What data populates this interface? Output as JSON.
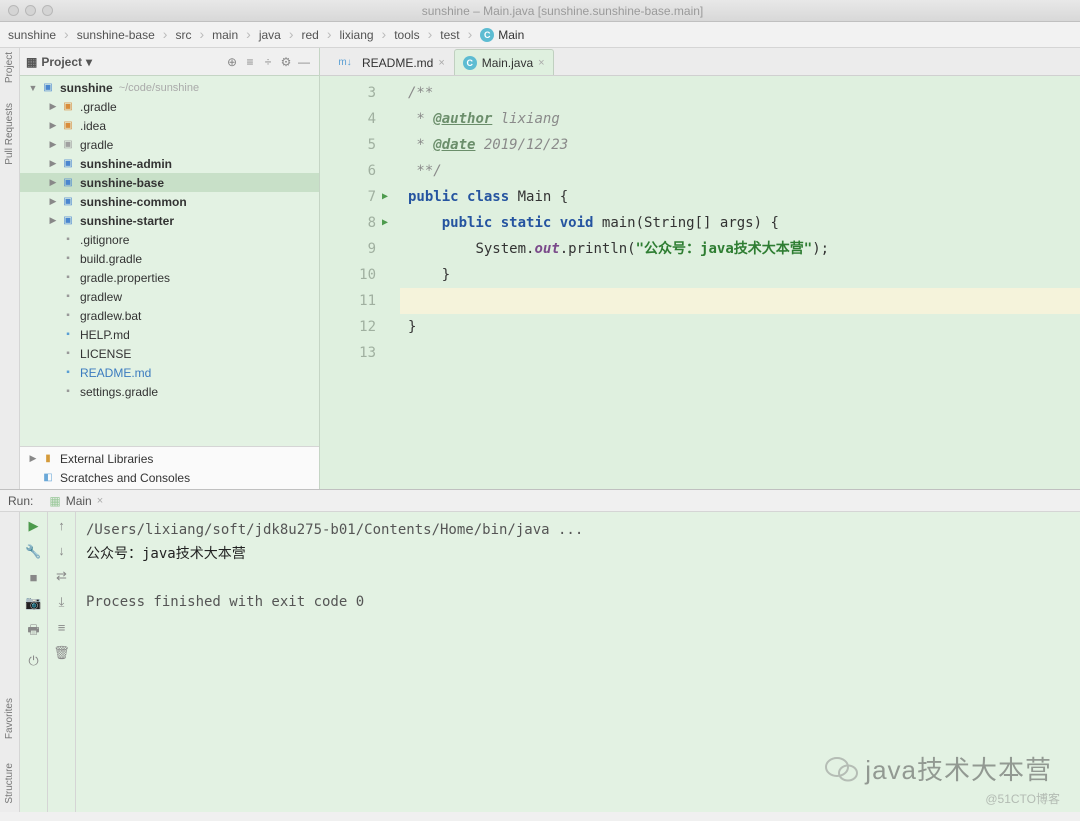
{
  "window": {
    "title": "sunshine – Main.java [sunshine.sunshine-base.main]"
  },
  "breadcrumb": [
    "sunshine",
    "sunshine-base",
    "src",
    "main",
    "java",
    "red",
    "lixiang",
    "tools",
    "test",
    "Main"
  ],
  "project": {
    "title": "Project",
    "root_name": "sunshine",
    "root_path": "~/code/sunshine",
    "items": [
      {
        "t": ".gradle",
        "ic": "folder-orange",
        "l": 2,
        "tw": "▶"
      },
      {
        "t": ".idea",
        "ic": "folder-orange",
        "l": 2,
        "tw": "▶"
      },
      {
        "t": "gradle",
        "ic": "folder-gray",
        "l": 2,
        "tw": "▶"
      },
      {
        "t": "sunshine-admin",
        "ic": "folder-blue",
        "l": 2,
        "tw": "▶",
        "bold": true
      },
      {
        "t": "sunshine-base",
        "ic": "folder-blue",
        "l": 2,
        "tw": "▶",
        "bold": true,
        "sel": true
      },
      {
        "t": "sunshine-common",
        "ic": "folder-blue",
        "l": 2,
        "tw": "▶",
        "bold": true
      },
      {
        "t": "sunshine-starter",
        "ic": "folder-blue",
        "l": 2,
        "tw": "▶",
        "bold": true
      },
      {
        "t": ".gitignore",
        "ic": "file-gray",
        "l": 2
      },
      {
        "t": "build.gradle",
        "ic": "file-gray",
        "l": 2
      },
      {
        "t": "gradle.properties",
        "ic": "file-gray",
        "l": 2
      },
      {
        "t": "gradlew",
        "ic": "file-gray",
        "l": 2
      },
      {
        "t": "gradlew.bat",
        "ic": "file-gray",
        "l": 2
      },
      {
        "t": "HELP.md",
        "ic": "file-md",
        "l": 2
      },
      {
        "t": "LICENSE",
        "ic": "file-gray",
        "l": 2
      },
      {
        "t": "README.md",
        "ic": "file-md",
        "l": 2,
        "color": "#3b7bbf"
      },
      {
        "t": "settings.gradle",
        "ic": "file-gray",
        "l": 2
      }
    ],
    "ext1": "External Libraries",
    "ext2": "Scratches and Consoles"
  },
  "tabs": [
    {
      "label": "README.md",
      "icon": "md"
    },
    {
      "label": "Main.java",
      "icon": "class",
      "active": true
    }
  ],
  "editor": {
    "lines": [
      3,
      4,
      5,
      6,
      7,
      8,
      9,
      10,
      11,
      12,
      13
    ],
    "runmarks": {
      "7": true,
      "8": true
    },
    "code": {
      "l3": "/**",
      "l4_pre": " * ",
      "l4_tag": "@author",
      "l4_rest": " lixiang",
      "l5_pre": " * ",
      "l5_tag": "@date",
      "l5_rest": " 2019/12/23",
      "l6": " **/",
      "l7_a": "public",
      "l7_b": "class",
      "l7_c": " Main {",
      "l8_a": "public",
      "l8_b": "static",
      "l8_c": "void",
      "l8_d": " main(String[] args) {",
      "l9_a": "System.",
      "l9_b": "out",
      "l9_c": ".println(",
      "l9_d": "\"公众号：java技术大本营\"",
      "l9_e": ");",
      "l10": "    }",
      "l12": "}"
    }
  },
  "run": {
    "label": "Run:",
    "tab": "Main",
    "out1": "/Users/lixiang/soft/jdk8u275-b01/Contents/Home/bin/java ...",
    "out2": "公众号：java技术大本营",
    "out3": "Process finished with exit code 0"
  },
  "watermark": "java技术大本营",
  "watermark2": "@51CTO博客",
  "rails": {
    "left1": "Project",
    "left2": "Pull Requests",
    "bottom1": "Favorites",
    "bottom2": "Structure"
  }
}
